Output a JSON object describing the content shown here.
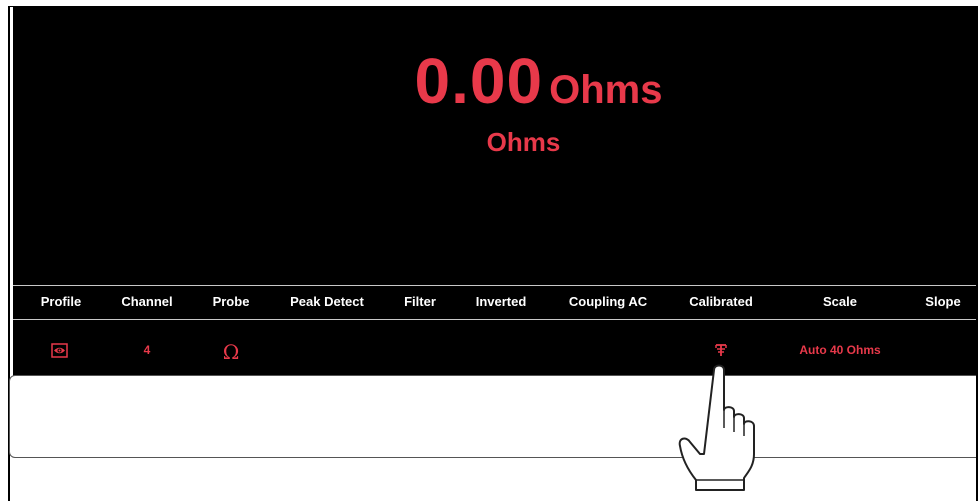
{
  "display": {
    "value": "0.00",
    "unit": "Ohms",
    "sub_unit": "Ohms"
  },
  "toolbar": {
    "columns": [
      {
        "header": "Profile",
        "value": ""
      },
      {
        "header": "Channel",
        "value": "4"
      },
      {
        "header": "Probe",
        "value": ""
      },
      {
        "header": "Peak Detect",
        "value": ""
      },
      {
        "header": "Filter",
        "value": ""
      },
      {
        "header": "Inverted",
        "value": ""
      },
      {
        "header": "Coupling AC",
        "value": ""
      },
      {
        "header": "Calibrated",
        "value": ""
      },
      {
        "header": "Scale",
        "value": "Auto 40 Ohms"
      },
      {
        "header": "Slope",
        "value": ""
      }
    ],
    "probe_symbol": "Ω",
    "profile_icon": "eye-icon",
    "calibrated_icon": "calibrate-icon"
  },
  "colors": {
    "accent": "#e8394a",
    "screen_bg": "#000000",
    "header_text": "#ffffff"
  },
  "overlay": {
    "pointer_icon": "hand-pointer-icon"
  }
}
